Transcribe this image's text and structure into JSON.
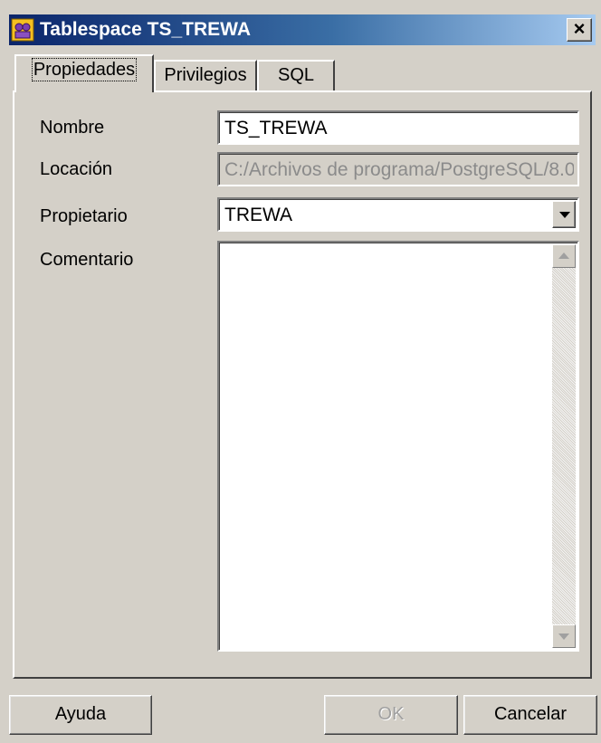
{
  "window": {
    "title": "Tablespace TS_TREWA",
    "close_symbol": "×",
    "title_icon": "tablespace-icon"
  },
  "tabs": [
    {
      "label": "Propiedades",
      "active": true
    },
    {
      "label": "Privilegios",
      "active": false
    },
    {
      "label": "SQL",
      "active": false
    }
  ],
  "form": {
    "name_label": "Nombre",
    "name_value": "TS_TREWA",
    "location_label": "Locación",
    "location_value": "C:/Archivos de programa/PostgreSQL/8.0",
    "owner_label": "Propietario",
    "owner_value": "TREWA",
    "comment_label": "Comentario",
    "comment_value": ""
  },
  "buttons": {
    "help": "Ayuda",
    "ok": "OK",
    "cancel": "Cancelar"
  },
  "colors": {
    "titlebar_start": "#0a246a",
    "titlebar_end": "#a6caf0",
    "face": "#d4d0c8"
  }
}
